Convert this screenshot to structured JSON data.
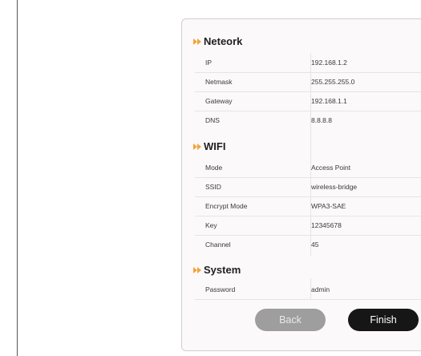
{
  "network": {
    "title": "Neteork",
    "rows": [
      {
        "key": "IP",
        "value": "192.168.1.2"
      },
      {
        "key": "Netmask",
        "value": "255.255.255.0"
      },
      {
        "key": "Gateway",
        "value": "192.168.1.1"
      },
      {
        "key": "DNS",
        "value": "8.8.8.8"
      }
    ]
  },
  "wifi": {
    "title": "WIFI",
    "rows": [
      {
        "key": "Mode",
        "value": "Access Point"
      },
      {
        "key": "SSID",
        "value": "wireless-bridge"
      },
      {
        "key": "Encrypt Mode",
        "value": "WPA3-SAE"
      },
      {
        "key": "Key",
        "value": "12345678"
      },
      {
        "key": "Channel",
        "value": "45"
      }
    ]
  },
  "system": {
    "title": "System",
    "rows": [
      {
        "key": "Password",
        "value": "admin"
      }
    ]
  },
  "buttons": {
    "back": "Back",
    "finish": "Finish"
  },
  "colors": {
    "accent_arrow": "#f2a43a",
    "button_back": "#9e9e9e",
    "button_finish": "#161616"
  }
}
